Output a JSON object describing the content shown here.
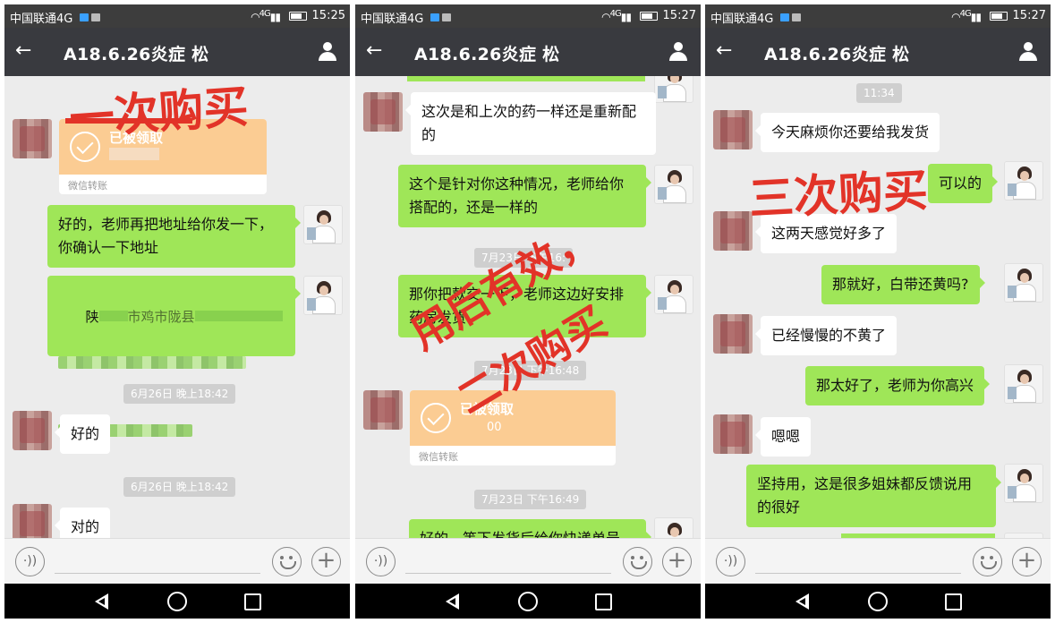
{
  "status_bar": {
    "carrier": "中国联通4G",
    "network": "4G"
  },
  "chat_title": "A18.6.26炎症 松",
  "screens": [
    {
      "time": "15:25",
      "stamp": "一次购买",
      "messages": {
        "transfer": {
          "status": "已被领取",
          "amount": "",
          "label": "微信转账"
        },
        "m1": "好的，老师再把地址给你发一下，你确认一下地址",
        "m2_prefix": "陕",
        "m2_fragment": "市鸡市陇县",
        "ts1": "6月26日 晚上18:42",
        "m3": "好的",
        "ts2": "6月26日 晚上18:42",
        "m4": "对的"
      }
    },
    {
      "time": "15:27",
      "stamp_line1": "用后有效，",
      "stamp_line2": "二次购买",
      "messages": {
        "m1": "这次是和上次的药一样还是重新配的",
        "m2": "这个是针对你这种情况，老师给你搭配的，还是一样的",
        "ts1": "7月23日 下午16:",
        "m3": "那你把款交一下，老师这边好安排药房发货",
        "ts2": "7月23日 下午16:48",
        "transfer": {
          "status": "已被领取",
          "amount": "00",
          "label": "微信转账"
        },
        "ts3": "7月23日 下午16:49",
        "m4": "好的，等下发货后给你快递单号"
      }
    },
    {
      "time": "15:27",
      "stamp": "三次购买",
      "messages": {
        "ts1": "11:34",
        "m1": "今天麻烦你还要给我发货",
        "m2": "可以的",
        "m3": "这两天感觉好多了",
        "m4": "那就好，白带还黄吗?",
        "m5": "已经慢慢的不黄了",
        "m6": "那太好了，老师为你高兴",
        "m7": "嗯嗯",
        "m8": "坚持用，这是很多姐妹都反馈说用的很好"
      }
    }
  ],
  "icons": {
    "back": "←",
    "voice": "·))",
    "plus": "+"
  },
  "colors": {
    "status_bar": "#3d3d3d",
    "title_bar": "#393a3f",
    "chat_bg": "#ececec",
    "outgoing_bubble": "#9fe658",
    "incoming_bubble": "#ffffff",
    "transfer_card": "#fbcc93",
    "stamp_red": "#e23328"
  }
}
